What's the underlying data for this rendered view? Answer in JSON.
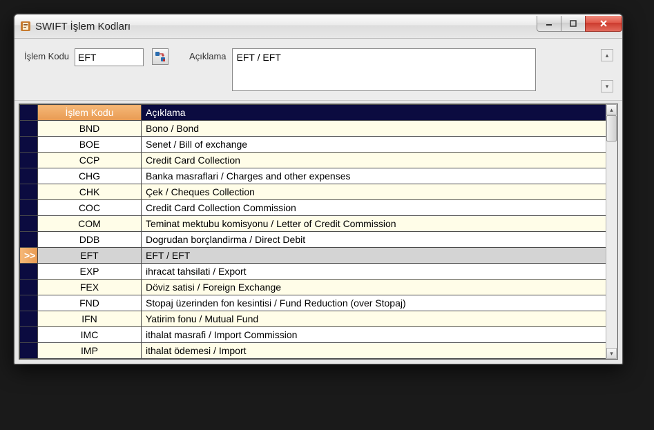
{
  "window": {
    "title": "SWIFT İşlem Kodları"
  },
  "form": {
    "islem_kodu_label": "İşlem Kodu",
    "islem_kodu_value": "EFT",
    "aciklama_label": "Açıklama",
    "aciklama_value": "EFT / EFT"
  },
  "grid": {
    "headers": {
      "islem_kodu": "İşlem Kodu",
      "aciklama": "Açıklama"
    },
    "selected_code": "EFT",
    "rows": [
      {
        "code": "BND",
        "desc": "Bono / Bond"
      },
      {
        "code": "BOE",
        "desc": "Senet / Bill of exchange"
      },
      {
        "code": "CCP",
        "desc": "Credit Card Collection"
      },
      {
        "code": "CHG",
        "desc": "Banka masraflari / Charges and other expenses"
      },
      {
        "code": "CHK",
        "desc": "Çek / Cheques Collection"
      },
      {
        "code": "COC",
        "desc": "Credit Card Collection Commission"
      },
      {
        "code": "COM",
        "desc": "Teminat mektubu komisyonu / Letter of Credit Commission"
      },
      {
        "code": "DDB",
        "desc": "Dogrudan borçlandirma / Direct Debit"
      },
      {
        "code": "EFT",
        "desc": "EFT / EFT"
      },
      {
        "code": "EXP",
        "desc": "ihracat tahsilati / Export"
      },
      {
        "code": "FEX",
        "desc": "Döviz satisi / Foreign Exchange"
      },
      {
        "code": "FND",
        "desc": "Stopaj üzerinden fon kesintisi / Fund Reduction (over Stopaj)"
      },
      {
        "code": "IFN",
        "desc": "Yatirim fonu / Mutual Fund"
      },
      {
        "code": "IMC",
        "desc": "ithalat masrafi / Import Commission"
      },
      {
        "code": "IMP",
        "desc": "ithalat ödemesi / Import"
      }
    ]
  }
}
